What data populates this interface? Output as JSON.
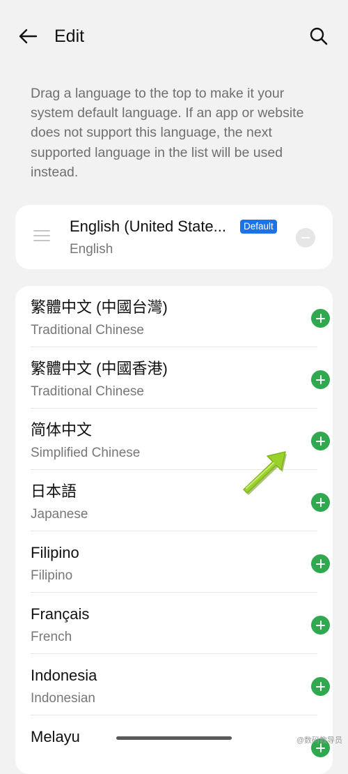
{
  "header": {
    "title": "Edit"
  },
  "description": "Drag a language to the top to make it your system default language. If an app or website does not support this language, the next supported language in the list will be used instead.",
  "default_language": {
    "name": "English (United State...",
    "native": "English",
    "badge": "Default"
  },
  "languages": [
    {
      "name": "繁體中文 (中國台灣)",
      "sub": "Traditional Chinese"
    },
    {
      "name": "繁體中文 (中國香港)",
      "sub": "Traditional Chinese"
    },
    {
      "name": "简体中文",
      "sub": "Simplified Chinese"
    },
    {
      "name": "日本語",
      "sub": "Japanese"
    },
    {
      "name": "Filipino",
      "sub": "Filipino"
    },
    {
      "name": "Français",
      "sub": "French"
    },
    {
      "name": "Indonesia",
      "sub": "Indonesian"
    },
    {
      "name": "Melayu",
      "sub": ""
    }
  ],
  "watermark": "@数码教导员",
  "icons": {
    "back": "arrow-left-icon",
    "search": "search-icon",
    "drag": "drag-handle-icon",
    "remove": "minus-circle-icon",
    "add": "plus-circle-icon",
    "annotation": "green-arrow-annotation"
  },
  "colors": {
    "background": "#f2f2f2",
    "card": "#ffffff",
    "accent_blue": "#1a73e8",
    "add_green": "#2fa84f",
    "annotation_arrow": "#9ad12a"
  }
}
